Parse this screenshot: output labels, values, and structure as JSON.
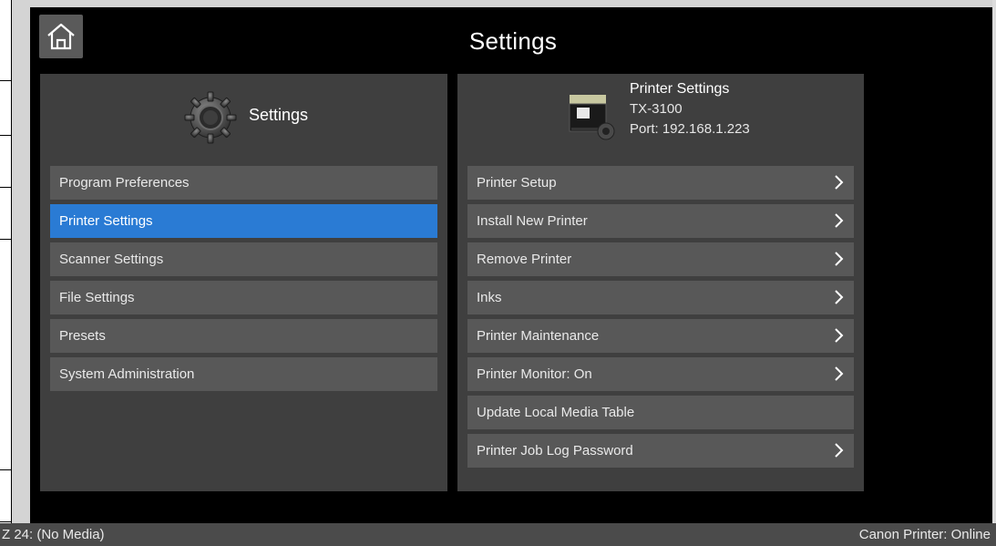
{
  "header": {
    "title": "Settings"
  },
  "left_panel": {
    "header_label": "Settings",
    "items": [
      {
        "label": "Program Preferences",
        "selected": false
      },
      {
        "label": "Printer Settings",
        "selected": true
      },
      {
        "label": "Scanner Settings",
        "selected": false
      },
      {
        "label": "File Settings",
        "selected": false
      },
      {
        "label": "Presets",
        "selected": false
      },
      {
        "label": "System Administration",
        "selected": false
      }
    ]
  },
  "right_panel": {
    "header_title": "Printer Settings",
    "model": "TX-3100",
    "port": "Port: 192.168.1.223",
    "items": [
      {
        "label": "Printer Setup",
        "has_chevron": true
      },
      {
        "label": "Install New Printer",
        "has_chevron": true
      },
      {
        "label": "Remove Printer",
        "has_chevron": true
      },
      {
        "label": "Inks",
        "has_chevron": true
      },
      {
        "label": "Printer Maintenance",
        "has_chevron": true
      },
      {
        "label": "Printer Monitor: On",
        "has_chevron": true
      },
      {
        "label": "Update Local Media Table",
        "has_chevron": false
      },
      {
        "label": "Printer Job Log Password",
        "has_chevron": true
      }
    ]
  },
  "status_bar": {
    "left": "Z 24: (No Media)",
    "right": "Canon Printer: Online"
  },
  "colors": {
    "background": "#000000",
    "panel": "#3f3f3f",
    "item": "#585858",
    "selected": "#2a7bd4",
    "text": "#ffffff"
  },
  "icons": {
    "home": "home-icon",
    "gear": "gear-icon",
    "printer": "printer-icon",
    "chevron": "chevron-right-icon"
  }
}
